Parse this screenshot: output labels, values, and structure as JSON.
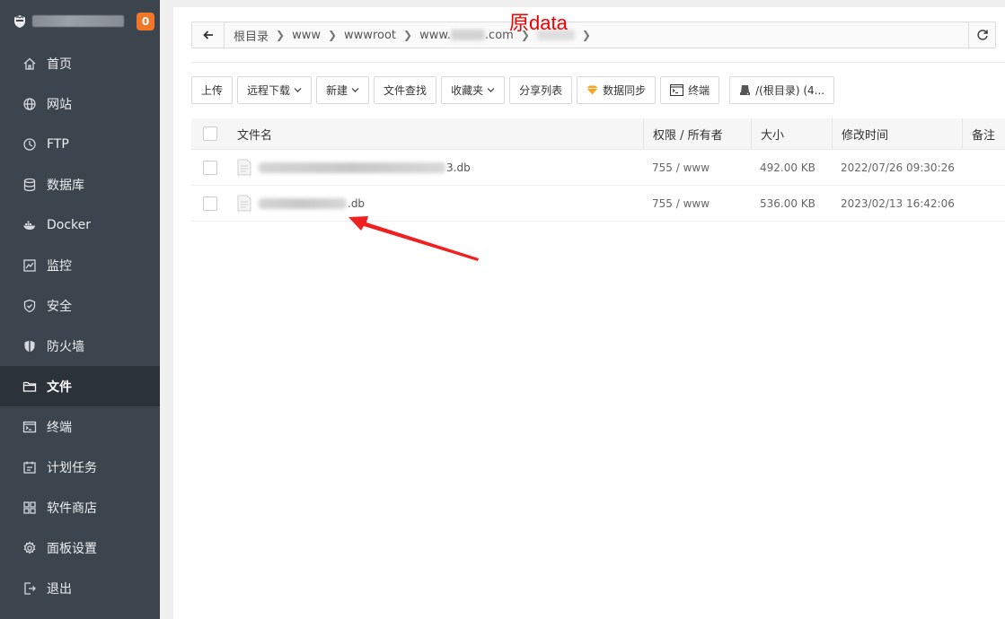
{
  "sidebar": {
    "badge": "0",
    "items": [
      {
        "label": "首页",
        "icon": "home-icon"
      },
      {
        "label": "网站",
        "icon": "globe-icon"
      },
      {
        "label": "FTP",
        "icon": "ftp-icon"
      },
      {
        "label": "数据库",
        "icon": "database-icon"
      },
      {
        "label": "Docker",
        "icon": "docker-icon"
      },
      {
        "label": "监控",
        "icon": "monitor-icon"
      },
      {
        "label": "安全",
        "icon": "shield-check-icon"
      },
      {
        "label": "防火墙",
        "icon": "firewall-icon"
      },
      {
        "label": "文件",
        "icon": "folder-icon"
      },
      {
        "label": "终端",
        "icon": "terminal-icon"
      },
      {
        "label": "计划任务",
        "icon": "calendar-icon"
      },
      {
        "label": "软件商店",
        "icon": "grid-icon"
      },
      {
        "label": "面板设置",
        "icon": "gear-icon"
      },
      {
        "label": "退出",
        "icon": "logout-icon"
      }
    ],
    "active_index": 8
  },
  "overlay_label": "原data",
  "breadcrumb": {
    "root": "根目录",
    "seg1": "www",
    "seg2": "wwwroot",
    "seg3_prefix": "www.",
    "seg3_suffix": ".com"
  },
  "toolbar": {
    "upload": "上传",
    "remote_download": "远程下载",
    "new": "新建",
    "file_search": "文件查找",
    "favorites": "收藏夹",
    "share_list": "分享列表",
    "data_sync": "数据同步",
    "terminal": "终端",
    "path": "/(根目录) (4..."
  },
  "table": {
    "headers": {
      "name": "文件名",
      "perm": "权限 / 所有者",
      "size": "大小",
      "mtime": "修改时间",
      "note": "备注"
    },
    "rows": [
      {
        "name_suffix": "3.db",
        "perm": "755 / www",
        "size": "492.00 KB",
        "mtime": "2022/07/26 09:30:26"
      },
      {
        "name_suffix": ".db",
        "perm": "755 / www",
        "size": "536.00 KB",
        "mtime": "2023/02/13 16:42:06"
      }
    ]
  },
  "colors": {
    "sidebar_bg": "#3c444d",
    "sidebar_active": "#2c3239",
    "badge": "#f0762a",
    "annotation": "#f20000"
  }
}
